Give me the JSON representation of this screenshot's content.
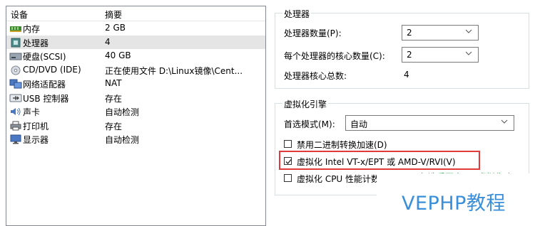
{
  "devices": {
    "headers": {
      "device": "设备",
      "summary": "摘要"
    },
    "rows": [
      {
        "name": "内存",
        "summary": "2 GB",
        "icon": "memory-icon",
        "selected": false
      },
      {
        "name": "处理器",
        "summary": "4",
        "icon": "processor-icon",
        "selected": true
      },
      {
        "name": "硬盘(SCSI)",
        "summary": "40 GB",
        "icon": "hard-disk-icon",
        "selected": false
      },
      {
        "name": "CD/DVD (IDE)",
        "summary": "正在使用文件 D:\\Linux镜像\\Cent...",
        "icon": "cd-dvd-icon",
        "selected": false
      },
      {
        "name": "网络适配器",
        "summary": "NAT",
        "icon": "network-adapter-icon",
        "selected": false
      },
      {
        "name": "USB 控制器",
        "summary": "存在",
        "icon": "usb-icon",
        "selected": false
      },
      {
        "name": "声卡",
        "summary": "自动检测",
        "icon": "sound-card-icon",
        "selected": false
      },
      {
        "name": "打印机",
        "summary": "存在",
        "icon": "printer-icon",
        "selected": false
      },
      {
        "name": "显示器",
        "summary": "自动检测",
        "icon": "display-icon",
        "selected": false
      }
    ]
  },
  "processors": {
    "group_title": "处理器",
    "count_label": "处理器数量(P):",
    "count_value": "2",
    "cores_label": "每个处理器的核心数量(C):",
    "cores_value": "2",
    "total_label": "处理器核心总数:",
    "total_value": "4"
  },
  "virtualization": {
    "group_title": "虚拟化引擎",
    "mode_label": "首选模式(M):",
    "mode_value": "自动",
    "options": [
      {
        "label": "禁用二进制转换加速(D)",
        "checked": false
      },
      {
        "label": "虚拟化 Intel VT-x/EPT 或 AMD-V/RVI(V)",
        "checked": true
      },
      {
        "label": "虚拟化 CPU 性能计数器(U)",
        "checked": false
      }
    ]
  },
  "overlay": {
    "watermark": "VEPHP教程",
    "green_note": "勾选后开启cpu虚拟化功"
  },
  "colors": {
    "highlight": "#e03a3a",
    "watermark": "#3a8fd8",
    "note": "#2aa84a",
    "selected_row": "#e5e5e5"
  }
}
